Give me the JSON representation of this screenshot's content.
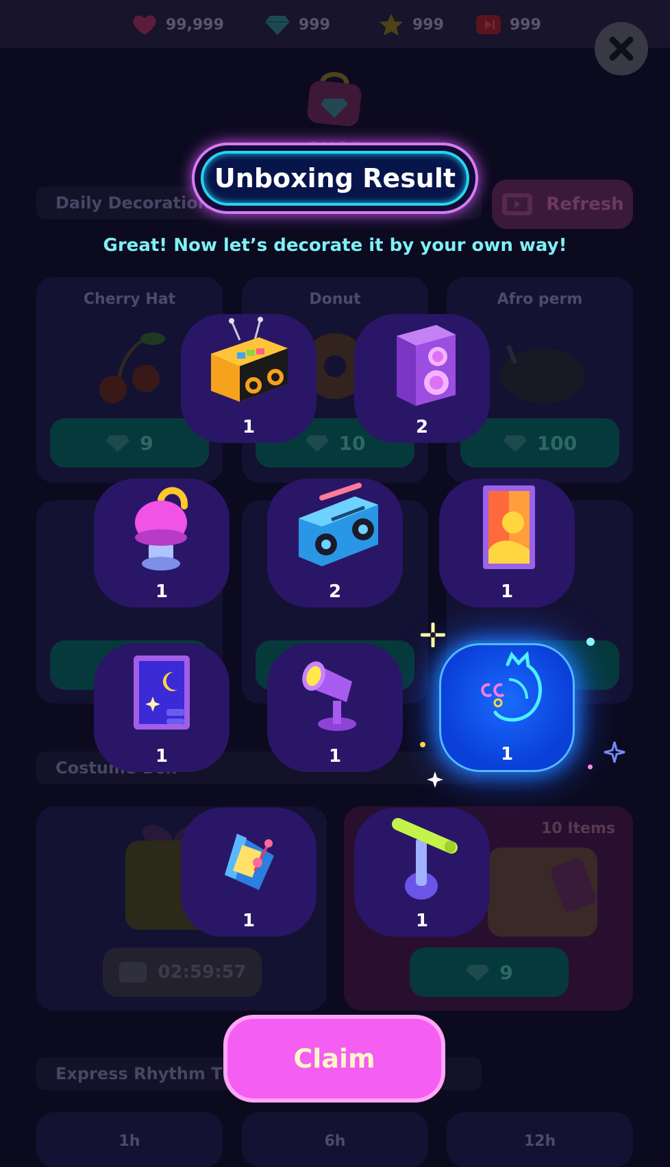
{
  "currencies": [
    {
      "icon": "heart-icon",
      "value": "99,999"
    },
    {
      "icon": "gem-icon",
      "value": "999"
    },
    {
      "icon": "star-icon",
      "value": "999"
    },
    {
      "icon": "video-ticket-icon",
      "value": "999"
    }
  ],
  "shop": {
    "title": "SHOP",
    "daily_section": "Daily Decoration Items",
    "refresh_label": "Refresh",
    "daily_items": [
      {
        "name": "Cherry Hat",
        "price": "9"
      },
      {
        "name": "Donut",
        "price": "10"
      },
      {
        "name": "Afro perm",
        "price": "100"
      }
    ],
    "costume_section": "Costume Box",
    "box_timer": "02:59:57",
    "box_items_label": "10 Items",
    "box_price": "9",
    "express_section": "Express Rhythm Tickets",
    "ticket_labels": [
      "1h",
      "6h",
      "12h"
    ]
  },
  "result": {
    "title": "Unboxing Result",
    "subtitle": "Great! Now let’s decorate it by your own way!",
    "items": [
      {
        "icon": "boombox-yellow-icon",
        "count": "1"
      },
      {
        "icon": "speaker-purple-icon",
        "count": "2"
      },
      {
        "icon": "mushroom-lamp-icon",
        "count": "1"
      },
      {
        "icon": "boombox-blue-icon",
        "count": "2"
      },
      {
        "icon": "sunset-poster-icon",
        "count": "1"
      },
      {
        "icon": "moon-poster-icon",
        "count": "1"
      },
      {
        "icon": "spotlight-icon",
        "count": "1"
      },
      {
        "icon": "neon-cat-sign-icon",
        "count": "1",
        "highlighted": true
      },
      {
        "icon": "metronome-icon",
        "count": "1"
      },
      {
        "icon": "light-stand-icon",
        "count": "1"
      }
    ],
    "claim_label": "Claim"
  },
  "colors": {
    "accent_pink": "#f45ef2",
    "accent_cyan": "#25d5ef",
    "item_tile": "#2a1667",
    "highlight_blue": "#1a6bff"
  }
}
